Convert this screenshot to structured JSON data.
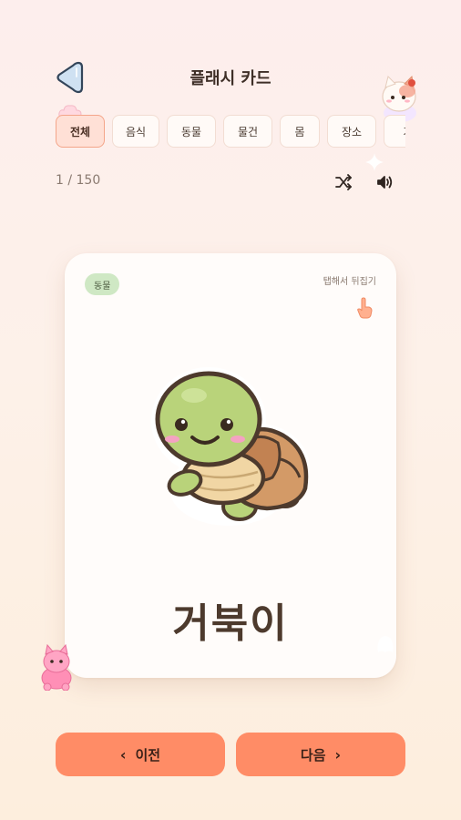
{
  "header": {
    "title": "플래시 카드",
    "back_icon": "back-arrow-icon"
  },
  "tabs": [
    {
      "label": "전체",
      "active": true
    },
    {
      "label": "음식",
      "active": false
    },
    {
      "label": "동물",
      "active": false
    },
    {
      "label": "물건",
      "active": false
    },
    {
      "label": "몸",
      "active": false
    },
    {
      "label": "장소",
      "active": false
    },
    {
      "label": "가",
      "active": false
    }
  ],
  "progress": {
    "counter": "1 / 150",
    "shuffle_icon": "shuffle-icon",
    "sound_icon": "speaker-icon"
  },
  "card": {
    "category": "동물",
    "hint": "탭해서 뒤집기",
    "hint_icon": "tap-hand-icon",
    "image": "turtle-illustration",
    "word": "거북이"
  },
  "footer": {
    "prev_label": "이전",
    "next_label": "다음"
  },
  "colors": {
    "accent": "#ff8c66",
    "badge_bg": "#cfe8c4",
    "active_tab_bg": "#ffe0d6"
  }
}
